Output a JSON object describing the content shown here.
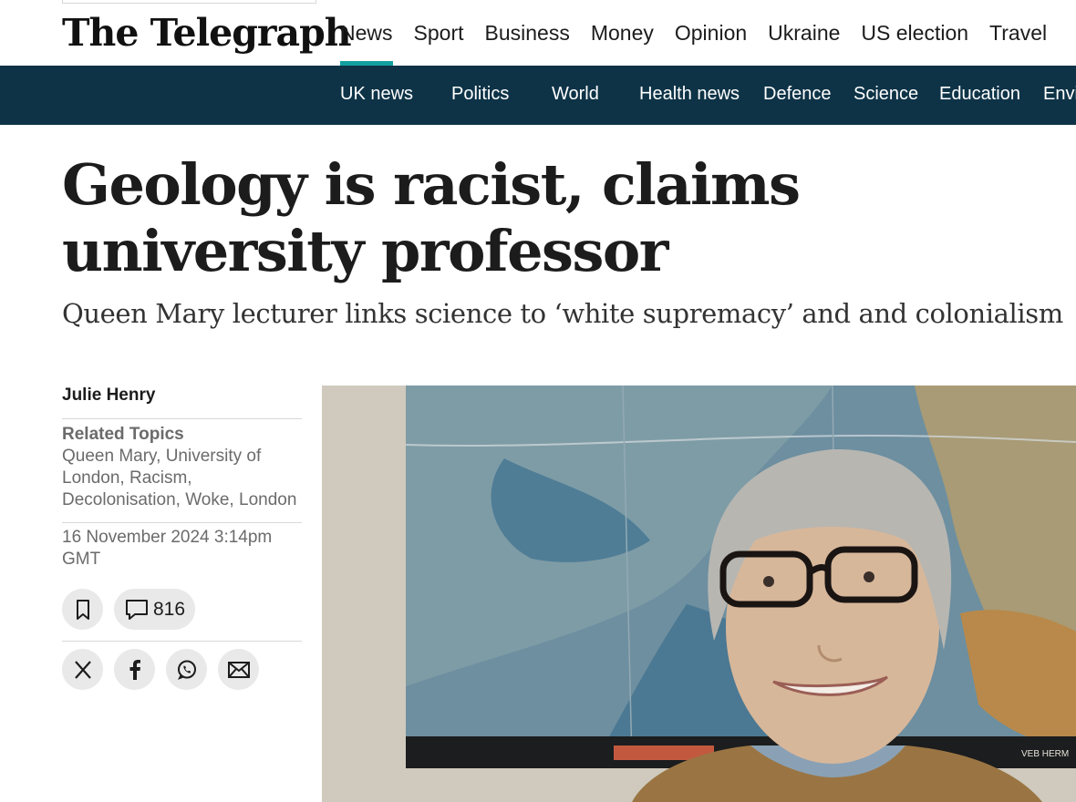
{
  "masthead": {
    "logo_text": "The Telegraph",
    "primary_nav": [
      {
        "label": "News",
        "active": true
      },
      {
        "label": "Sport"
      },
      {
        "label": "Business"
      },
      {
        "label": "Money"
      },
      {
        "label": "Opinion"
      },
      {
        "label": "Ukraine"
      },
      {
        "label": "US election"
      },
      {
        "label": "Travel"
      }
    ],
    "accent_color": "#11a0a0"
  },
  "secondary_nav": {
    "background": "#0e3347",
    "items": [
      "UK news",
      "Politics",
      "World",
      "Health news",
      "Defence",
      "Science",
      "Education",
      "Envi"
    ]
  },
  "article": {
    "headline": "Geology is racist, claims university professor",
    "standfirst": "Queen Mary lecturer links science to ‘white supremacy’ and and colonialism",
    "author": "Julie Henry",
    "related_topics_heading": "Related Topics",
    "related_topics": [
      "Queen Mary, University of London,",
      "Racism,",
      "Decolonisation,",
      "Woke,",
      "London"
    ],
    "date": "16 November 2024 3:14pm GMT",
    "comment_count": "816",
    "icons": {
      "save": "bookmark-icon",
      "comments": "comment-icon",
      "share": [
        "x-icon",
        "facebook-icon",
        "whatsapp-icon",
        "email-icon"
      ]
    },
    "hero_image_caption_text": "VEB HERM"
  }
}
